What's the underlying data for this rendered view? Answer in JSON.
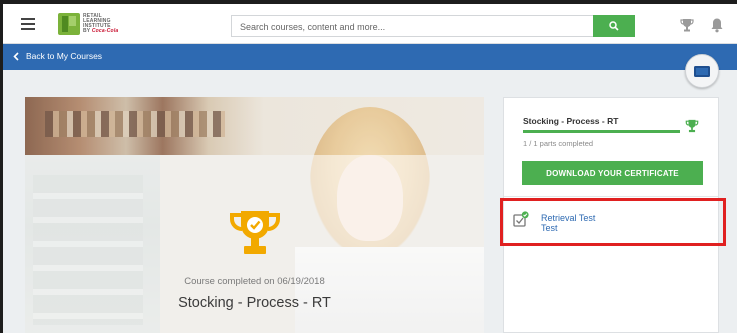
{
  "header": {
    "logo_text_line1": "RETAIL",
    "logo_text_line2": "LEARNING",
    "logo_text_line3": "INSTITUTE",
    "logo_text_line4": "BY",
    "logo_brand": "Coca-Cola",
    "search_placeholder": "Search courses, content and more..."
  },
  "nav": {
    "back_label": "Back to My Courses"
  },
  "hero": {
    "completed_text": "Course completed on 06/19/2018",
    "course_title": "Stocking - Process - RT"
  },
  "side_card": {
    "title": "Stocking - Process - RT",
    "progress": 1.0,
    "parts_text": "1 / 1 parts completed",
    "certificate_button": "DOWNLOAD YOUR CERTIFICATE",
    "items": [
      {
        "name": "Retrieval Test",
        "type": "Test"
      }
    ]
  },
  "colors": {
    "accent_green": "#4caf50",
    "nav_blue": "#2e6ab2",
    "trophy_gold": "#f2a900",
    "highlight_red": "#e02020"
  },
  "icons": [
    "menu-icon",
    "search-icon",
    "trophy-icon",
    "bell-icon",
    "chevron-left-icon",
    "video-icon",
    "checklist-icon"
  ]
}
